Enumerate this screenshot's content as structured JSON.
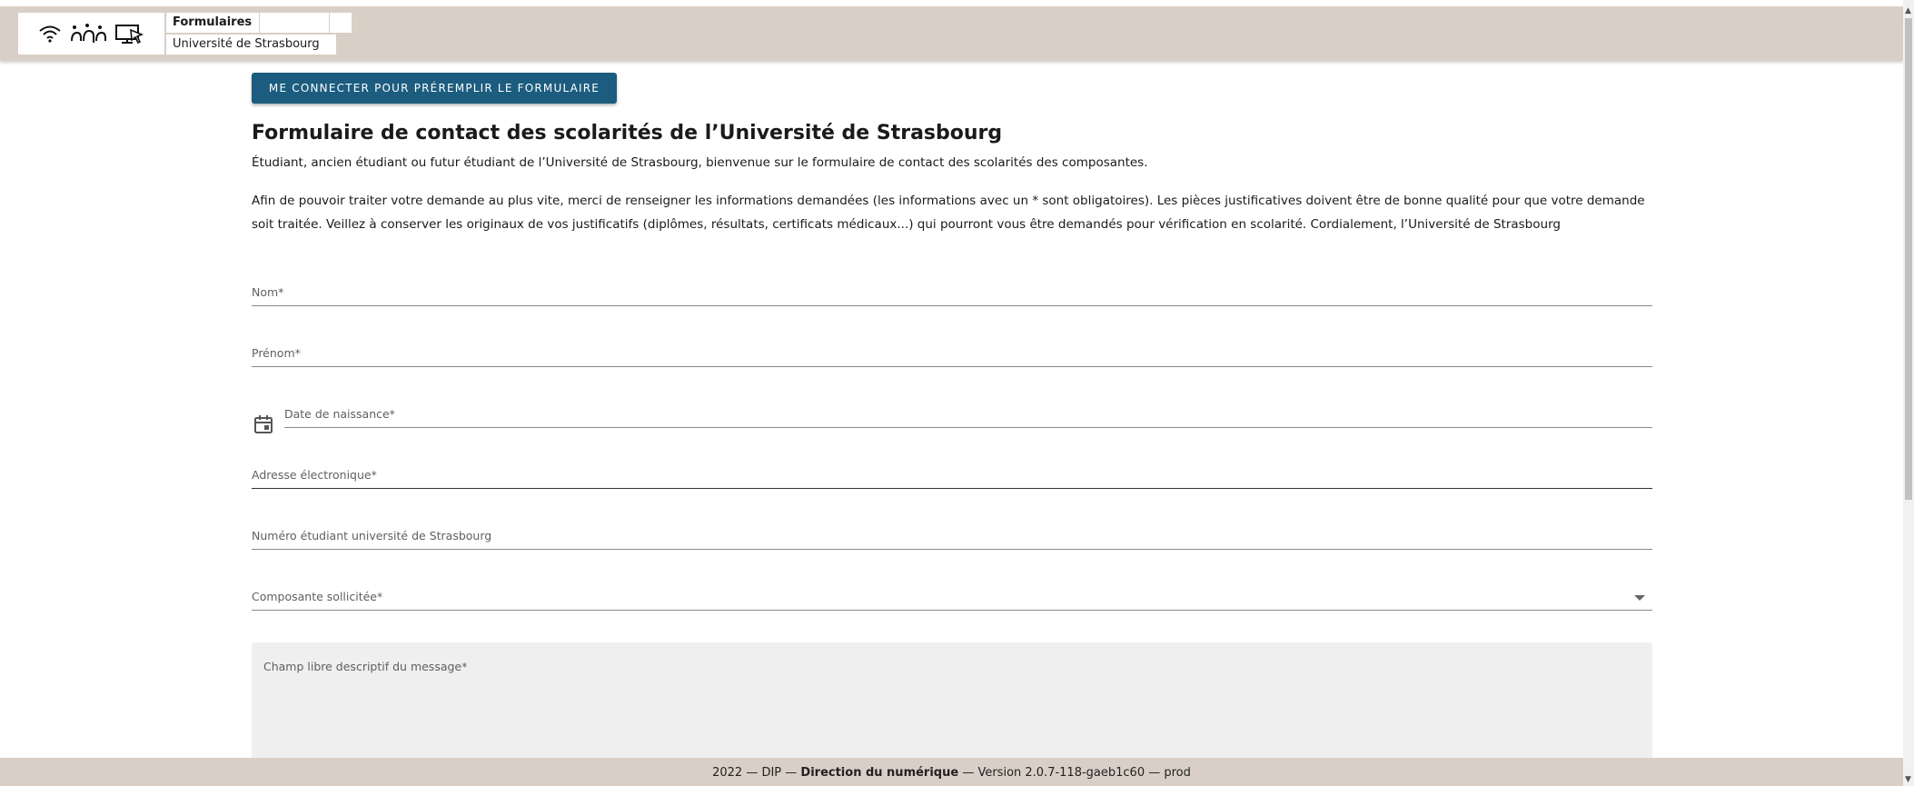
{
  "header": {
    "tab_title": "Formulaires",
    "subtitle": "Université de Strasbourg",
    "icons": [
      "wifi-icon",
      "network-icon",
      "screen-cursor-icon"
    ]
  },
  "form": {
    "login_button": "ME CONNECTER POUR PRÉREMPLIR LE FORMULAIRE",
    "title": "Formulaire de contact des scolarités de l’Université de Strasbourg",
    "intro": "Étudiant, ancien étudiant ou futur étudiant de l’Université de Strasbourg, bienvenue sur le formulaire de contact des scolarités des composantes.",
    "description": "Afin de pouvoir traiter votre demande au plus vite, merci de renseigner les informations demandées (les informations avec un * sont obligatoires). Les pièces justificatives doivent être de bonne qualité pour que votre demande soit traitée. Veillez à conserver les originaux de vos justificatifs (diplômes, résultats, certificats médicaux...) qui pourront vous être demandés pour vérification en scolarité. Cordialement, l’Université de Strasbourg",
    "fields": {
      "nom": "Nom*",
      "prenom": "Prénom*",
      "date_naissance": "Date de naissance*",
      "email": "Adresse électronique*",
      "numero_etudiant": "Numéro étudiant université de Strasbourg",
      "composante": "Composante sollicitée*",
      "message": "Champ libre descriptif du message*"
    }
  },
  "footer": {
    "year": "2022",
    "org_short": "DIP",
    "org_full": "Direction du numérique",
    "version": "Version 2.0.7-118-gaeb1c60",
    "env": "prod"
  },
  "colors": {
    "topbar_bg": "#d9cfc6",
    "button_bg": "#1c5c7f",
    "textarea_bg": "#efefef"
  }
}
